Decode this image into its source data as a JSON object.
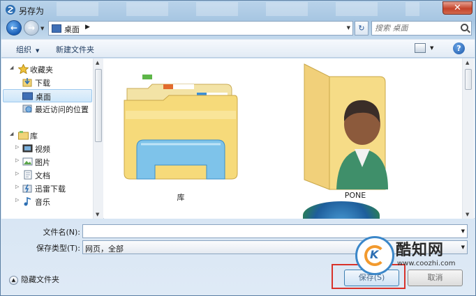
{
  "window": {
    "title": "另存为"
  },
  "address": {
    "current": "桌面"
  },
  "search": {
    "placeholder": "搜索 桌面"
  },
  "toolbar": {
    "organize_label": "组织",
    "new_folder_label": "新建文件夹"
  },
  "sidebar": {
    "favorites": {
      "label": "收藏夹",
      "items": [
        {
          "label": "下载"
        },
        {
          "label": "桌面"
        },
        {
          "label": "最近访问的位置"
        }
      ]
    },
    "libraries": {
      "label": "库",
      "items": [
        {
          "label": "视频"
        },
        {
          "label": "图片"
        },
        {
          "label": "文档"
        },
        {
          "label": "迅雷下载"
        },
        {
          "label": "音乐"
        }
      ]
    }
  },
  "files": [
    {
      "label": "库",
      "icon": "library-folder-icon"
    },
    {
      "label": "PONE",
      "icon": "user-folder-icon"
    }
  ],
  "form": {
    "filename_label": "文件名(N):",
    "filename_value": "",
    "filetype_label": "保存类型(T):",
    "filetype_value": "网页，全部",
    "hide_folders_label": "隐藏文件夹"
  },
  "buttons": {
    "save": "保存(S)",
    "cancel": "取消"
  },
  "watermark": {
    "title": "酷知网",
    "url": "www.coozhi.com"
  },
  "colors": {
    "accent": "#3c7fb1",
    "highlight": "#d8322a",
    "selection": "#cde6f9"
  }
}
